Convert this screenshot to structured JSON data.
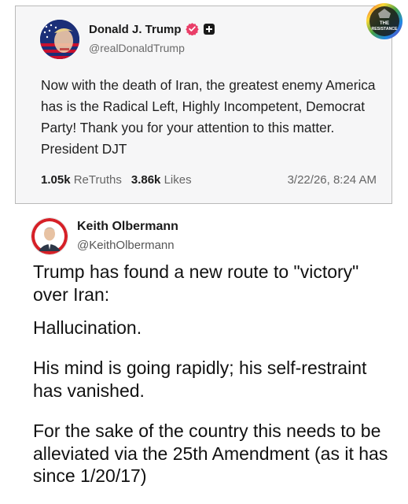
{
  "post1": {
    "author_name": "Donald J. Trump",
    "handle": "@realDonaldTrump",
    "body": "Now with the death of Iran, the greatest enemy America has is the Radical Left, Highly Incompetent, Democrat Party! Thank you for your attention to this matter. President DJT",
    "retruths_count": "1.05k",
    "retruths_label": "ReTruths",
    "likes_count": "3.86k",
    "likes_label": "Likes",
    "timestamp": "3/22/26, 8:24 AM"
  },
  "watermark": {
    "line1": "THE",
    "line2": "RESISTANCE"
  },
  "post2": {
    "author_name": "Keith Olbermann",
    "handle": "@KeithOlbermann",
    "paragraphs": [
      "Trump has found a new route to \"victory\" over Iran:",
      "Hallucination.",
      "His mind is going rapidly; his self-restraint has vanished.",
      "For the sake of the country this needs to be alleviated via the 25th Amendment (as it has since 1/20/17)"
    ]
  },
  "colors": {
    "verified_badge": "#e93e68",
    "card_background": "#f6f6f7",
    "card_border": "#b9b9b9",
    "avatar_red": "#d62027"
  },
  "icons": [
    "verified-badge-icon",
    "plus-badge-icon",
    "resistance-logo"
  ]
}
